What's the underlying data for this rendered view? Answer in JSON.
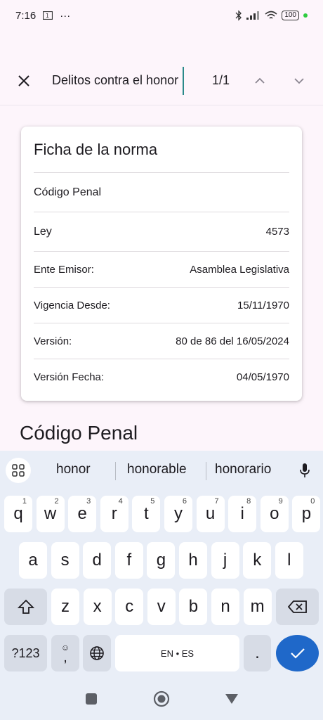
{
  "status_bar": {
    "time": "7:16",
    "dots": "···",
    "battery": "100"
  },
  "find_bar": {
    "query": "Delitos contra el honor",
    "match_count": "1/1"
  },
  "card": {
    "title": "Ficha de la norma",
    "norm_name": "Código Penal",
    "rows": [
      {
        "label": "Ley",
        "value": "4573"
      },
      {
        "label": "Ente Emisor:",
        "value": "Asamblea Legislativa"
      },
      {
        "label": "Vigencia Desde:",
        "value": "15/11/1970"
      },
      {
        "label": "Versión:",
        "value": "80 de 86 del 16/05/2024"
      },
      {
        "label": "Versión Fecha:",
        "value": "04/05/1970"
      }
    ]
  },
  "section_heading": "Código Penal",
  "keyboard": {
    "suggestions": [
      "honor",
      "honorable",
      "honorario"
    ],
    "row1": [
      {
        "k": "q",
        "h": "1"
      },
      {
        "k": "w",
        "h": "2"
      },
      {
        "k": "e",
        "h": "3"
      },
      {
        "k": "r",
        "h": "4"
      },
      {
        "k": "t",
        "h": "5"
      },
      {
        "k": "y",
        "h": "6"
      },
      {
        "k": "u",
        "h": "7"
      },
      {
        "k": "i",
        "h": "8"
      },
      {
        "k": "o",
        "h": "9"
      },
      {
        "k": "p",
        "h": "0"
      }
    ],
    "row2": [
      "a",
      "s",
      "d",
      "f",
      "g",
      "h",
      "j",
      "k",
      "l"
    ],
    "row3": [
      "z",
      "x",
      "c",
      "v",
      "b",
      "n",
      "m"
    ],
    "symbols_label": "?123",
    "comma_label": ",",
    "space_label": "EN • ES",
    "period_label": "."
  },
  "colors": {
    "accent": "#1f68c9",
    "background": "#fdf5fb",
    "keyboard": "#e9eef7"
  }
}
